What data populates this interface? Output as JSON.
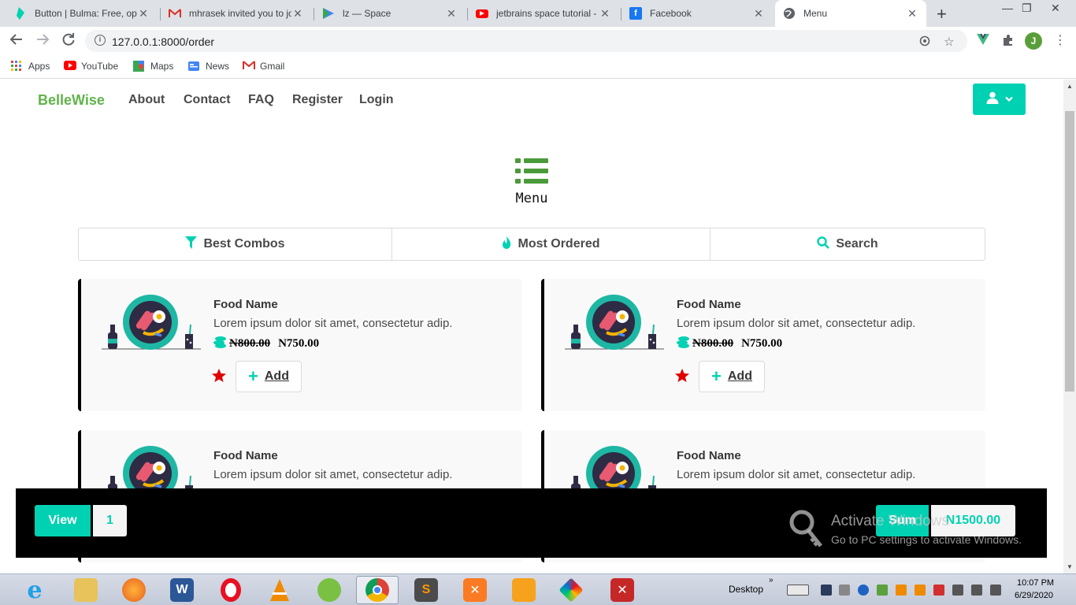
{
  "browser": {
    "tabs": [
      {
        "title": "Button | Bulma: Free, ope",
        "color": "#00d1b2"
      },
      {
        "title": "mhrasek invited you to jo",
        "color": "#d93025"
      },
      {
        "title": "lz — Space",
        "color": "#4285f4"
      },
      {
        "title": "jetbrains space tutorial -",
        "color": "#ff0000"
      },
      {
        "title": "Facebook",
        "color": "#1877f2"
      },
      {
        "title": "Menu",
        "color": "#5f6368"
      }
    ],
    "url": "127.0.0.1:8000/order",
    "profile_initial": "J",
    "bookmarks": [
      "Apps",
      "YouTube",
      "Maps",
      "News",
      "Gmail"
    ]
  },
  "site": {
    "brand": "BelleWise",
    "nav": [
      "About",
      "Contact",
      "FAQ",
      "Register",
      "Login"
    ],
    "accent": "#00d1b2"
  },
  "menu": {
    "title": "Menu",
    "tabs": [
      "Best Combos",
      "Most Ordered",
      "Search"
    ],
    "items": [
      {
        "name": "Food Name",
        "description": "Lorem ipsum dolor sit amet, consectetur adip.",
        "old_price": "N800.00",
        "price": "N750.00",
        "add_label": "Add"
      },
      {
        "name": "Food Name",
        "description": "Lorem ipsum dolor sit amet, consectetur adip.",
        "old_price": "N800.00",
        "price": "N750.00",
        "add_label": "Add"
      },
      {
        "name": "Food Name",
        "description": "Lorem ipsum dolor sit amet, consectetur adip."
      },
      {
        "name": "Food Name",
        "description": "Lorem ipsum dolor sit amet, consectetur adip."
      }
    ]
  },
  "cart": {
    "view_label": "View",
    "count": "1",
    "sum_label": "Sum",
    "sum_value": "N1500.00"
  },
  "watermark": {
    "line1": "Activate Windows",
    "line2": "Go to PC settings to activate Windows."
  },
  "taskbar": {
    "desktop_label": "Desktop",
    "time": "10:07 PM",
    "date": "6/29/2020"
  }
}
